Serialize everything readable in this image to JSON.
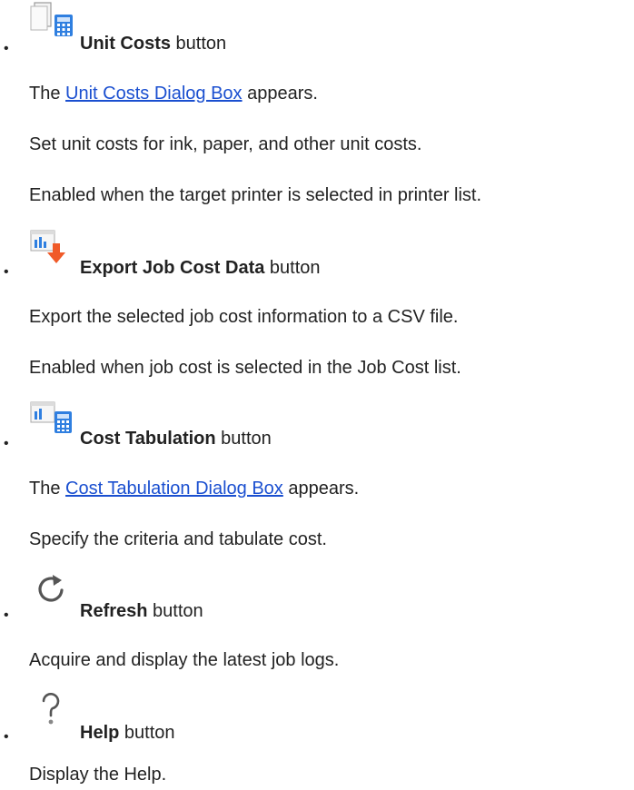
{
  "items": [
    {
      "icon": "unit-costs-icon",
      "name": "Unit Costs",
      "suffix": " button",
      "lines": [
        {
          "prefix": "The ",
          "link": "Unit Costs Dialog Box",
          "suffix": " appears."
        },
        {
          "text": "Set unit costs for ink, paper, and other unit costs."
        },
        {
          "text": "Enabled when the target printer is selected in printer list."
        }
      ]
    },
    {
      "icon": "export-job-cost-icon",
      "name": "Export Job Cost Data",
      "suffix": " button",
      "lines": [
        {
          "text": "Export the selected job cost information to a CSV file."
        },
        {
          "text": "Enabled when job cost is selected in the Job Cost list."
        }
      ]
    },
    {
      "icon": "cost-tabulation-icon",
      "name": "Cost Tabulation",
      "suffix": " button",
      "lines": [
        {
          "prefix": "The ",
          "link": "Cost Tabulation Dialog Box",
          "suffix": " appears."
        },
        {
          "text": "Specify the criteria and tabulate cost."
        }
      ]
    },
    {
      "icon": "refresh-icon",
      "name": "Refresh",
      "suffix": " button",
      "lines": [
        {
          "text": "Acquire and display the latest job logs."
        }
      ]
    },
    {
      "icon": "help-icon",
      "name": "Help",
      "suffix": " button",
      "lines": [
        {
          "text": "Display the Help."
        }
      ]
    }
  ],
  "bullet_char": "•",
  "colors": {
    "text": "#222222",
    "link": "#1a4fd0",
    "accent_blue": "#2f7fe0",
    "accent_orange": "#f05a28"
  }
}
